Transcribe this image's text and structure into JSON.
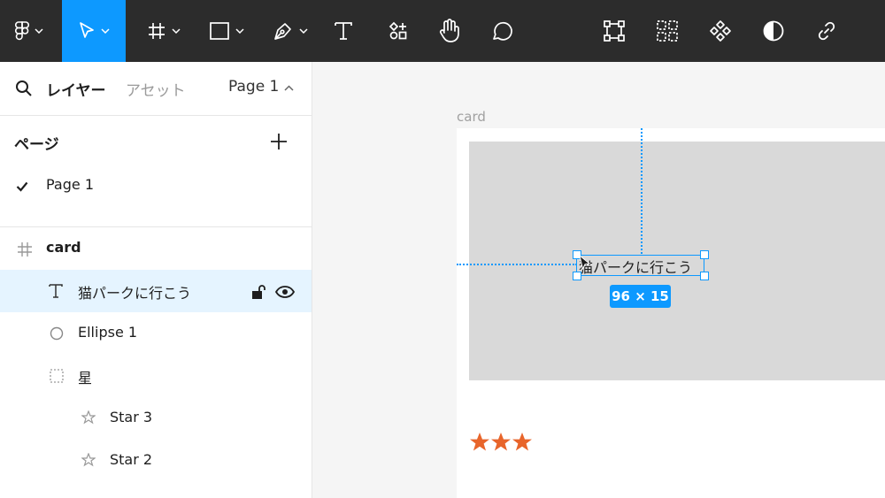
{
  "toolbar": {
    "tools": [
      {
        "name": "figma-main-menu",
        "icon": "figma-logo-icon",
        "has_dropdown": true
      },
      {
        "name": "move-tool",
        "icon": "pointer-arrow-icon",
        "has_dropdown": true,
        "active": true
      },
      {
        "name": "frame-tool",
        "icon": "frame-hash-icon",
        "has_dropdown": true
      },
      {
        "name": "shape-tool",
        "icon": "rectangle-icon",
        "has_dropdown": true
      },
      {
        "name": "pen-tool",
        "icon": "pen-icon",
        "has_dropdown": true
      },
      {
        "name": "text-tool",
        "icon": "text-t-icon",
        "has_dropdown": false
      },
      {
        "name": "resources-tool",
        "icon": "resources-icon",
        "has_dropdown": false
      },
      {
        "name": "hand-tool",
        "icon": "hand-icon",
        "has_dropdown": false
      },
      {
        "name": "comment-tool",
        "icon": "comment-bubble-icon",
        "has_dropdown": false
      },
      {
        "name": "create-frame-selection",
        "icon": "frame-selection-icon"
      },
      {
        "name": "create-component-set",
        "icon": "component-set-icon"
      },
      {
        "name": "create-component",
        "icon": "component-icon"
      },
      {
        "name": "boolean-mask",
        "icon": "contrast-icon"
      },
      {
        "name": "link",
        "icon": "link-icon"
      }
    ],
    "active_color": "#0d99ff",
    "background": "#2c2c2c"
  },
  "left_panel": {
    "tabs": {
      "layers": "レイヤー",
      "assets": "アセット"
    },
    "current_page": "Page 1",
    "pages_heading": "ページ",
    "pages": [
      {
        "label": "Page 1",
        "checked": true
      }
    ],
    "layers": [
      {
        "label": "card",
        "icon": "frame-hash-icon",
        "bold": true
      },
      {
        "label": "猫パークに行こう",
        "icon": "text-t-icon",
        "selected": true
      },
      {
        "label": "Ellipse 1",
        "icon": "ellipse-icon"
      },
      {
        "label": "星",
        "icon": "dashed-group-icon"
      },
      {
        "label": "Star 3",
        "icon": "star-outline-icon"
      },
      {
        "label": "Star 2",
        "icon": "star-outline-icon"
      }
    ]
  },
  "canvas": {
    "frame_label": "card",
    "selected_text": "猫パークに行こう",
    "selection_size": "96 × 15",
    "stars": "★★★",
    "star_color": "#e8652b",
    "selection_color": "#0d99ff"
  }
}
